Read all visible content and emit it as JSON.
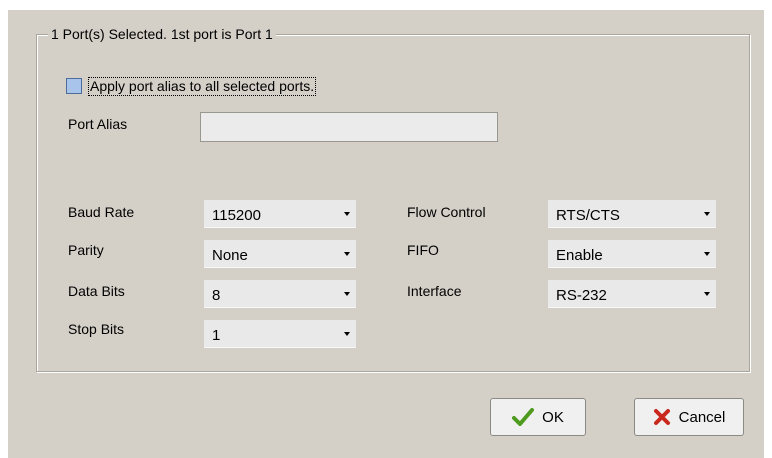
{
  "group": {
    "title": "1 Port(s) Selected. 1st port is Port 1"
  },
  "alias": {
    "apply_all_label": "Apply port alias to all selected ports.",
    "label": "Port Alias",
    "value": ""
  },
  "settings": {
    "baud_rate": {
      "label": "Baud Rate",
      "value": "115200"
    },
    "parity": {
      "label": "Parity",
      "value": "None"
    },
    "data_bits": {
      "label": "Data Bits",
      "value": "8"
    },
    "stop_bits": {
      "label": "Stop Bits",
      "value": "1"
    },
    "flow_control": {
      "label": "Flow Control",
      "value": "RTS/CTS"
    },
    "fifo": {
      "label": "FIFO",
      "value": "Enable"
    },
    "interface": {
      "label": "Interface",
      "value": "RS-232"
    }
  },
  "buttons": {
    "ok": "OK",
    "cancel": "Cancel"
  },
  "icons": {
    "ok": "checkmark-icon",
    "cancel": "x-mark-icon",
    "dropdown": "chevron-down-icon"
  },
  "colors": {
    "dialog_bg": "#d4d0c8",
    "check_green": "#4e9a1e",
    "cancel_red": "#c8281e",
    "checkbox_fill": "#a8c4ea"
  }
}
